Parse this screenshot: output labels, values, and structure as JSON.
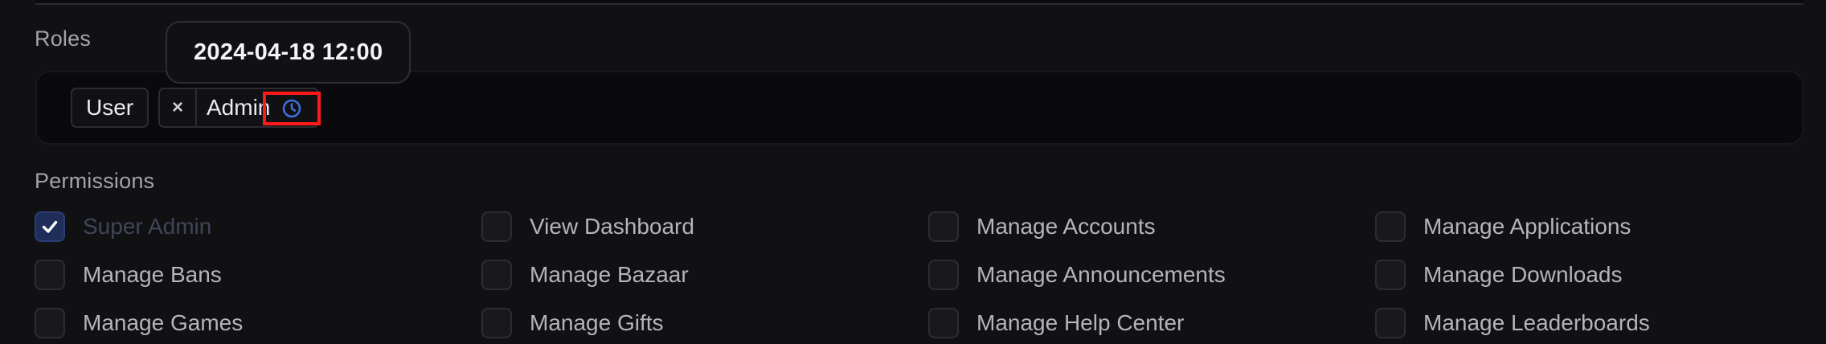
{
  "roles": {
    "label": "Roles",
    "chips": [
      {
        "label": "User"
      },
      {
        "label": "Admin",
        "remove_glyph": "×",
        "icon": "clock-icon"
      }
    ],
    "tooltip": "2024-04-18 12:00"
  },
  "permissions": {
    "label": "Permissions",
    "items": [
      {
        "label": "Super Admin",
        "checked": true
      },
      {
        "label": "View Dashboard",
        "checked": false
      },
      {
        "label": "Manage Accounts",
        "checked": false
      },
      {
        "label": "Manage Applications",
        "checked": false
      },
      {
        "label": "Manage Bans",
        "checked": false
      },
      {
        "label": "Manage Bazaar",
        "checked": false
      },
      {
        "label": "Manage Announcements",
        "checked": false
      },
      {
        "label": "Manage Downloads",
        "checked": false
      },
      {
        "label": "Manage Games",
        "checked": false
      },
      {
        "label": "Manage Gifts",
        "checked": false
      },
      {
        "label": "Manage Help Center",
        "checked": false
      },
      {
        "label": "Manage Leaderboards",
        "checked": false
      }
    ]
  },
  "colors": {
    "highlight": "#ff1a1a",
    "clock_icon": "#3b6fe0",
    "checked_bg": "#1e2d5a"
  }
}
